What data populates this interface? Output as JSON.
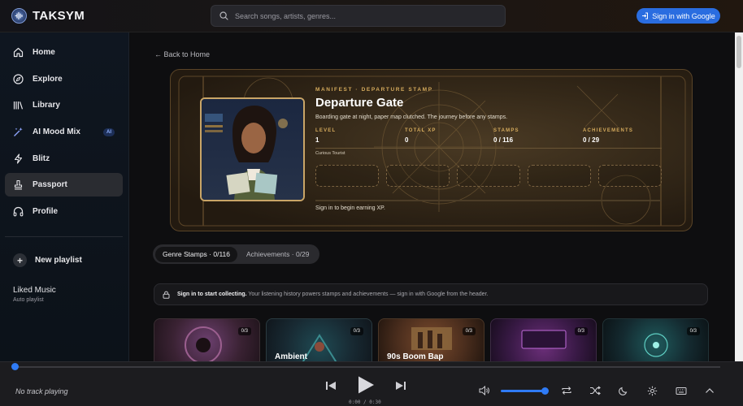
{
  "header": {
    "app_name": "TAKSYM",
    "search_placeholder": "Search songs, artists, genres...",
    "signin_label": "Sign in with Google"
  },
  "sidebar": {
    "items": [
      {
        "label": "Home",
        "icon": "home-icon"
      },
      {
        "label": "Explore",
        "icon": "compass-icon"
      },
      {
        "label": "Library",
        "icon": "library-icon"
      },
      {
        "label": "AI Mood Mix",
        "icon": "sparkle-wand-icon",
        "badge": "AI"
      },
      {
        "label": "Blitz",
        "icon": "lightning-icon"
      },
      {
        "label": "Passport",
        "icon": "stamp-icon",
        "active": true
      },
      {
        "label": "Profile",
        "icon": "headphones-icon"
      }
    ],
    "new_playlist_label": "New playlist",
    "liked": {
      "title": "Liked Music",
      "subtitle": "Auto playlist"
    }
  },
  "main": {
    "back_label": "← Back to Home",
    "hero": {
      "kicker": "MANIFEST · DEPARTURE STAMP",
      "title": "Departure Gate",
      "description": "Boarding gate at night, paper map clutched. The journey before any stamps.",
      "stats": [
        {
          "label": "LEVEL",
          "value": "1"
        },
        {
          "label": "TOTAL XP",
          "value": "0"
        },
        {
          "label": "STAMPS",
          "value": "0 / 116"
        },
        {
          "label": "ACHIEVEMENTS",
          "value": "0 / 29"
        }
      ],
      "tier_label": "Curious Tourist",
      "footer_text": "Sign in to begin earning XP."
    },
    "tabs": [
      {
        "label": "Genre Stamps · 0/116",
        "active": true
      },
      {
        "label": "Achievements · 0/29",
        "active": false
      }
    ],
    "notice": {
      "bold": "Sign in to start collecting.",
      "text": "Your listening history powers stamps and achievements — sign in with Google from the header."
    },
    "cards": [
      {
        "title": "",
        "count": "0/3"
      },
      {
        "title": "Ambient",
        "count": "0/3"
      },
      {
        "title": "90s Boom Bap",
        "count": "0/3"
      },
      {
        "title": "",
        "count": "0/3"
      },
      {
        "title": "",
        "count": "0/3"
      }
    ]
  },
  "player": {
    "now_playing": "No track playing",
    "time": "0:00 / 0:30",
    "progress": 0,
    "volume": 1.0
  },
  "colors": {
    "accent": "#2f7bf5",
    "gold": "#d4aa5c"
  }
}
